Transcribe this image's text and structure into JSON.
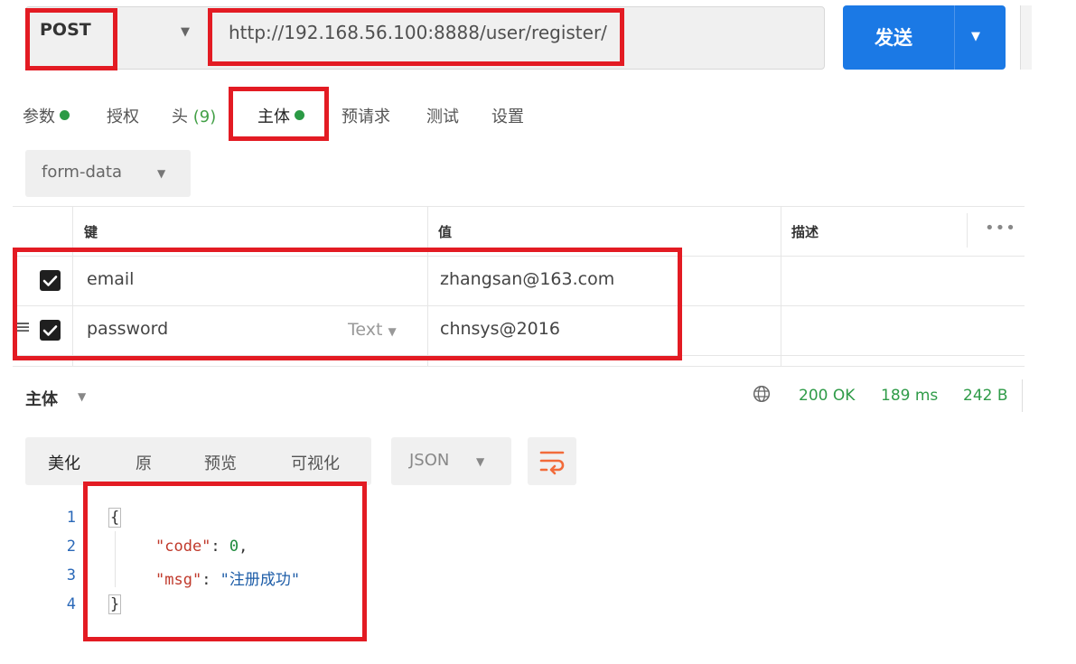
{
  "request": {
    "method": "POST",
    "url": "http://192.168.56.100:8888/user/register/",
    "send_label": "发送"
  },
  "request_tabs": [
    {
      "label": "参数",
      "dot": true
    },
    {
      "label": "授权"
    },
    {
      "label": "头",
      "count": "(9)"
    },
    {
      "label": "主体",
      "dot": true,
      "active": true
    },
    {
      "label": "预请求"
    },
    {
      "label": "测试"
    },
    {
      "label": "设置"
    }
  ],
  "body_mode": "form-data",
  "table": {
    "headers": {
      "key": "键",
      "value": "值",
      "description": "描述"
    },
    "rows": [
      {
        "checked": true,
        "key": "email",
        "value": "zhangsan@163.com",
        "description": ""
      },
      {
        "checked": true,
        "key": "password",
        "type": "Text",
        "value": "chnsys@2016",
        "description": ""
      }
    ]
  },
  "response": {
    "title": "主体",
    "status": "200 OK",
    "time": "189 ms",
    "size": "242 B",
    "view_tabs": [
      "美化",
      "原",
      "预览",
      "可视化"
    ],
    "active_view": "美化",
    "format": "JSON",
    "code_lines": [
      {
        "num": "1",
        "text": "{"
      },
      {
        "num": "2",
        "key": "\"code\"",
        "sep": ": ",
        "value": "0",
        "trail": ","
      },
      {
        "num": "3",
        "key": "\"msg\"",
        "sep": ": ",
        "value": "\"注册成功\"",
        "trail": ""
      },
      {
        "num": "4",
        "text": "}"
      }
    ]
  },
  "colors": {
    "accent": "#1b79e5",
    "success": "#2f9b48",
    "annotation": "#e31b23",
    "orange_icon": "#f26b3a"
  },
  "icons": [
    "chevron-down-icon",
    "more-icon",
    "drag-handle-icon",
    "globe-icon",
    "wrap-lines-icon",
    "checkmark-icon"
  ]
}
